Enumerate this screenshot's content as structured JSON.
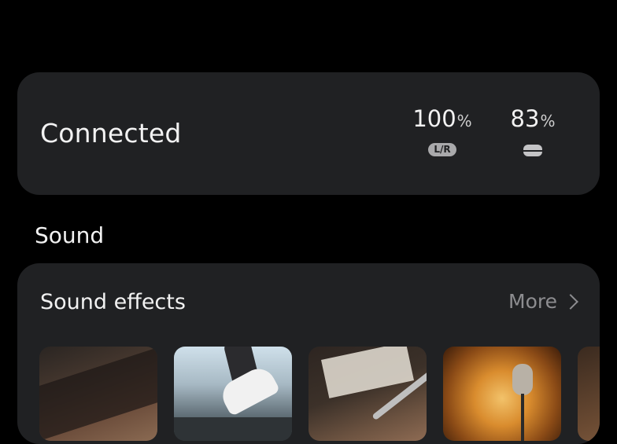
{
  "status_card": {
    "title": "Connected",
    "buds_battery": "100",
    "buds_unit": "%",
    "buds_badge": "L/R",
    "case_battery": "83",
    "case_unit": "%",
    "case_icon": "case-icon"
  },
  "sound_section": {
    "title": "Sound"
  },
  "sound_effects": {
    "title": "Sound effects",
    "more_label": "More",
    "more_icon": "chevron-right-icon",
    "thumbnails": [
      {
        "name": "effect-thumb-1"
      },
      {
        "name": "effect-thumb-2"
      },
      {
        "name": "effect-thumb-3"
      },
      {
        "name": "effect-thumb-4"
      },
      {
        "name": "effect-thumb-5"
      }
    ]
  },
  "colors": {
    "background": "#000000",
    "card": "#202123",
    "text": "#f2f2f2",
    "muted": "#8d8d90"
  }
}
